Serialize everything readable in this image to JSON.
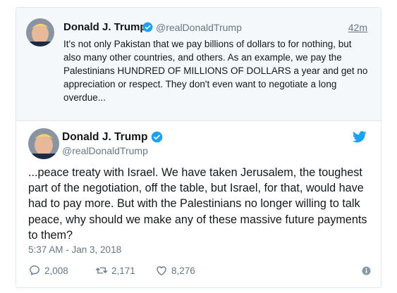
{
  "parent_tweet": {
    "name": "Donald J. Trump",
    "handle": "@realDonaldTrump",
    "time": "42m",
    "text": "It's not only Pakistan that we pay billions of dollars to for nothing, but also many other countries, and others. As an example, we pay the Palestinians HUNDRED OF MILLIONS OF DOLLARS a year and get no appreciation or respect. They don't even want to negotiate a long overdue..."
  },
  "main_tweet": {
    "name": "Donald J. Trump",
    "handle": "@realDonaldTrump",
    "text": "...peace treaty with Israel. We have taken Jerusalem, the toughest part of the negotiation, off the table, but Israel, for that, would have had to pay more. But with the Palestinians no longer willing to talk peace, why should we make any of these massive future payments to them?",
    "timestamp": "5:37 AM - Jan 3, 2018",
    "replies": "2,008",
    "retweets": "2,171",
    "likes": "8,276"
  },
  "icons": {
    "verified": "verified-badge-icon",
    "brand": "twitter-bird-icon",
    "reply": "reply-icon",
    "retweet": "retweet-icon",
    "like": "heart-icon",
    "info": "info-icon"
  },
  "colors": {
    "accent": "#1da1f2",
    "muted": "#657786",
    "text": "#14171a",
    "parent_background": "#f5f8fa"
  }
}
